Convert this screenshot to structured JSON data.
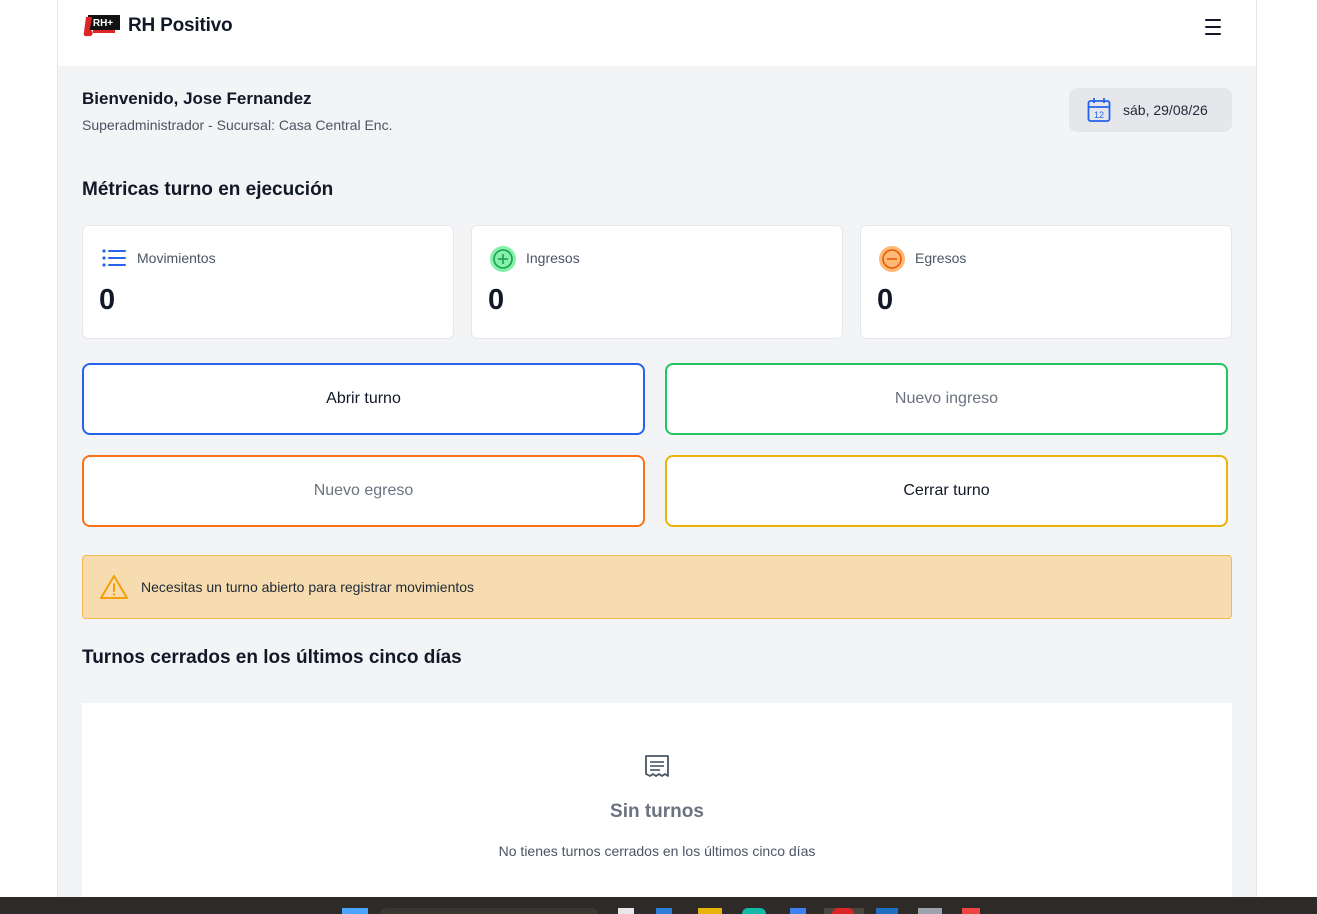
{
  "header": {
    "logo_text": "RH+",
    "brand": "RH Positivo",
    "menu_icon": "hamburger-icon"
  },
  "welcome": {
    "title": "Bienvenido, Jose Fernandez",
    "subtitle": "Superadministrador - Sucursal: Casa Central Enc.",
    "date": "sáb, 29/08/26",
    "date_icon": "calendar-icon",
    "calendar_day": "12"
  },
  "metrics": {
    "title": "Métricas turno en ejecución",
    "cards": [
      {
        "label": "Movimientos",
        "value": "0",
        "icon": "list-icon",
        "color": "#2563eb"
      },
      {
        "label": "Ingresos",
        "value": "0",
        "icon": "plus-circle-icon",
        "color": "#22c55e"
      },
      {
        "label": "Egresos",
        "value": "0",
        "icon": "minus-circle-icon",
        "color": "#f97316"
      }
    ]
  },
  "actions": {
    "open_shift": {
      "label": "Abrir turno",
      "border": "#2563eb"
    },
    "new_income": {
      "label": "Nuevo ingreso",
      "border": "#22c55e"
    },
    "new_expense": {
      "label": "Nuevo egreso",
      "border": "#f97316"
    },
    "close_shift": {
      "label": "Cerrar turno",
      "border": "#eab308"
    }
  },
  "alert": {
    "icon": "warning-icon",
    "text": "Necesitas un turno abierto para registrar movimientos"
  },
  "closed_shifts": {
    "title": "Turnos cerrados en los últimos cinco días",
    "empty_icon": "receipt-icon",
    "empty_title": "Sin turnos",
    "empty_text": "No tienes turnos cerrados en los últimos cinco días"
  }
}
